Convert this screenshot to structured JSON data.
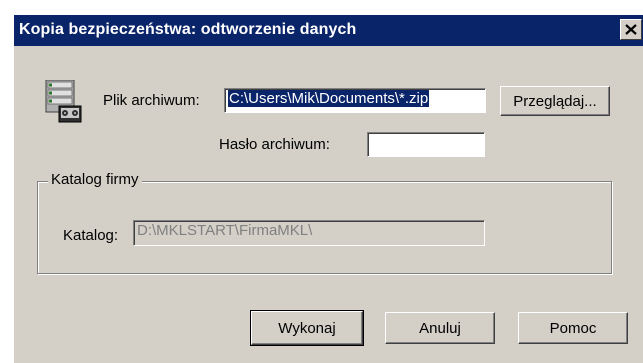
{
  "window": {
    "title": "Kopia bezpieczeństwa: odtworzenie danych",
    "title_bar_color": "#0a246a"
  },
  "archive": {
    "icon": "archive-tape-icon",
    "file_label": "Plik archiwum:",
    "file_value": "C:\\Users\\Mik\\Documents\\*.zip",
    "browse_label": "Przeglądaj...",
    "password_label": "Hasło archiwum:",
    "password_value": ""
  },
  "company_group": {
    "legend": "Katalog firmy",
    "directory_label": "Katalog:",
    "directory_value": "D:\\MKLSTART\\FirmaMKL\\"
  },
  "buttons": {
    "execute_label": "Wykonaj",
    "cancel_label": "Anuluj",
    "help_label": "Pomoc"
  }
}
